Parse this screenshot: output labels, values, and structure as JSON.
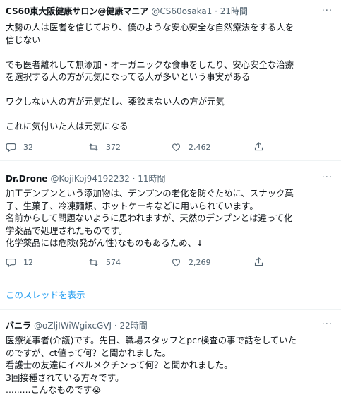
{
  "tweets": [
    {
      "name": "CS60東大阪健康サロン@健康マニア",
      "handle": "@CS60osaka1 · 21時間",
      "body": "大勢の人は医者を信じており、僕のような安心安全な自然療法をする人を\n信じない\n\nでも医者離れして無添加・オーガニックな食事をしたり、安心安全な治療\nを選択する人の方が元気になってる人が多いという事実がある\n\nワクしない人の方が元気だし、薬飲まない人の方が元気\n\nこれに気付いた人は元気になる",
      "replies": "32",
      "retweets": "372",
      "likes": "2,462"
    },
    {
      "name": "Dr.Drone",
      "handle": "@KojiKoj94192232 · 11時間",
      "body": "加工デンプンという添加物は、デンプンの老化を防ぐために、スナック菓\n子、生菓子、冷凍麺類、ホットケーキなどに用いられています。\n名前からして問題ないように思われますが、天然のデンプンとは違って化\n学薬品で処理されたものです。\n化学薬品には危険(発がん性)なものもあるため、↓",
      "replies": "12",
      "retweets": "574",
      "likes": "2,269"
    },
    {
      "name": "バニラ",
      "handle": "@oZljIWiWgixcGVJ · 22時間",
      "body": "医療従事者(介護)です。先日、職場スタッフとpcr検査の事で話をしていた\nのですが、ct値って何？と聞かれました。\n看護士の友達にイベルメクチンって何？と聞かれました。\n3回接種されている方々です。\n.........こんなものです",
      "emoji": "😭"
    }
  ],
  "thread_link": "このスレッドを表示",
  "more_glyph": "···",
  "icons": [
    "reply-icon",
    "retweet-icon",
    "like-icon",
    "share-icon"
  ],
  "colors": {
    "link": "#1d9bf0",
    "secondary": "#536471",
    "divider": "#eff3f4",
    "text": "#0f1419"
  }
}
